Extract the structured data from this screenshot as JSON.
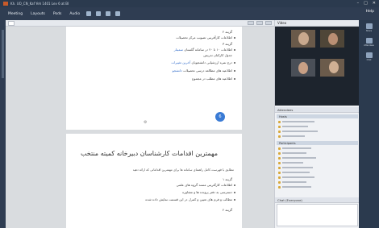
{
  "titlebar": {
    "title": "Kh. UO_CN_Kaf Yeh 1401 Lev 6 at BI",
    "controls": [
      "–",
      "□",
      "✕"
    ]
  },
  "menubar": {
    "items": [
      "Meeting",
      "Layouts",
      "Pods",
      "Audio"
    ],
    "help": "Help"
  },
  "document": {
    "tab_label": "",
    "page1": {
      "lines": [
        {
          "text": "گزینه ۲",
          "link": ""
        },
        {
          "text": "اطلاعات کارآفرینی تصویب مرکز تحصیلات",
          "link": ""
        },
        {
          "text": "گزینه ۳",
          "link": ""
        },
        {
          "text": "اطلاعات ۱۰ تا ۲۰ در سامانه گلستان",
          "link": "سمینار"
        },
        {
          "text": "جدول کارکنان تدریس",
          "link": ""
        },
        {
          "text": "درج نمره ارزشیابی دانشجویان",
          "link": "آخرین تغییرات"
        },
        {
          "text": "اطلاعیه های مطالعه درسی تحصیلات",
          "link": "دانشجو"
        },
        {
          "text": "اطلاعیه های مطلب در مجموع",
          "link": ""
        }
      ],
      "page_badge": "6"
    },
    "page2": {
      "title": "مهمترین اقدامات کارشناسان دبیرخانه کمیته منتخب",
      "intro": "مطابق با فهرست کامل راهنمای سامانه ها برای مهمترین اقداماتی که ارائه دهید",
      "lines": [
        {
          "text": "گزینه ۱",
          "link": ""
        },
        {
          "text": "اطلاعات کارآفرینی مسند گروه های علمی",
          "link": ""
        },
        {
          "text": "دسترسی به دفتر پرونده ها و مشاوره",
          "link": ""
        },
        {
          "text": "مطالب و فرم های تعیین و کنترل در این قسمت نمایش داده شده",
          "link": ""
        },
        {
          "text": "گزینه ۲",
          "link": ""
        }
      ]
    }
  },
  "video": {
    "header": "Video",
    "tiles": [
      {
        "name": ""
      },
      {
        "name": ""
      },
      {
        "name": ""
      },
      {
        "name": ""
      }
    ]
  },
  "attendees": {
    "header": "Attendees",
    "groups": [
      "Hosts",
      "Participants"
    ]
  },
  "chat": {
    "header": "Chat (Everyone)"
  },
  "farright": {
    "buttons": [
      "Share",
      "Attendees",
      "Chat"
    ]
  }
}
